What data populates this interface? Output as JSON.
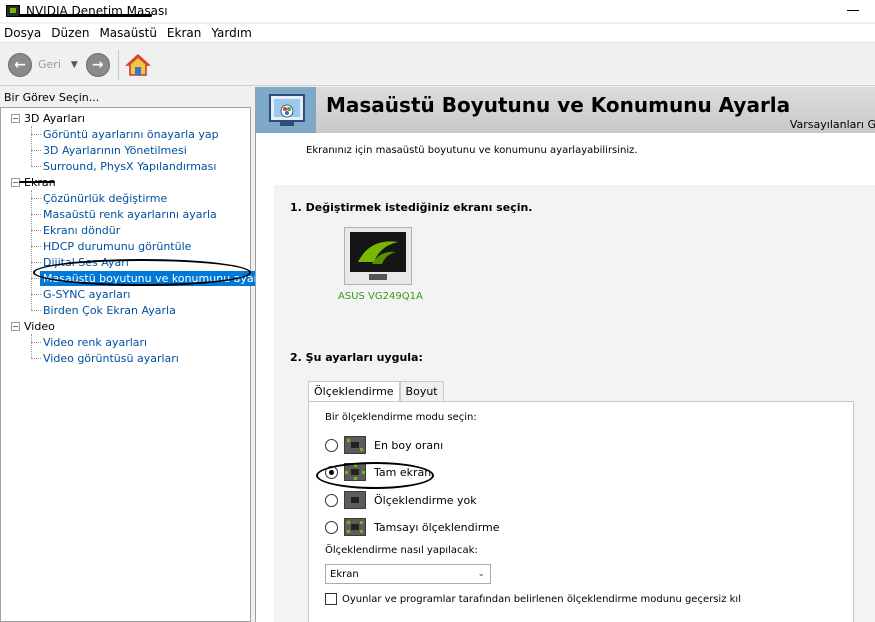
{
  "window": {
    "title": "NVIDIA Denetim Masası"
  },
  "menu": [
    "Dosya",
    "Düzen",
    "Masaüstü",
    "Ekran",
    "Yardım"
  ],
  "toolbar": {
    "back_label": "Geri",
    "back_icon": "arrow-left-icon",
    "forward_icon": "arrow-right-icon",
    "home_icon": "home-icon"
  },
  "left": {
    "header": "Bir Görev Seçin...",
    "tree": [
      {
        "label": "3D Ayarları",
        "expander": "−",
        "children": [
          "Görüntü ayarlarını önayarla yap",
          "3D Ayarlarının Yönetilmesi",
          "Surround, PhysX Yapılandırması"
        ]
      },
      {
        "label": "Ekran",
        "expander": "−",
        "children": [
          "Çözünürlük değiştirme",
          "Masaüstü renk ayarlarını ayarla",
          "Ekranı döndür",
          "HDCP durumunu görüntüle",
          "Dijital Ses Ayarı",
          "Masaüstü boyutunu ve konumunu ayarla",
          "G-SYNC ayarları",
          "Birden Çok Ekran Ayarla"
        ]
      },
      {
        "label": "Video",
        "expander": "−",
        "children": [
          "Video renk ayarları",
          "Video görüntüsü ayarları"
        ]
      }
    ],
    "selected": "Masaüstü boyutunu ve konumunu ayarla"
  },
  "right": {
    "title": "Masaüstü Boyutunu ve Konumunu Ayarla",
    "defaults": "Varsayılanları G",
    "description": "Ekranınız için masaüstü boyutunu ve konumunu ayarlayabilirsiniz.",
    "section1": "1. Değiştirmek istediğiniz ekranı seçin.",
    "monitor_label": "ASUS VG249Q1A",
    "section2": "2. Şu ayarları uygula:",
    "tabs": [
      "Ölçeklendirme",
      "Boyut"
    ],
    "scale_prompt": "Bir ölçeklendirme modu seçin:",
    "options": [
      {
        "label": "En boy oranı",
        "checked": false
      },
      {
        "label": "Tam ekran",
        "checked": true
      },
      {
        "label": "Ölçeklendirme yok",
        "checked": false
      },
      {
        "label": "Tamsayı ölçeklendirme",
        "checked": false
      }
    ],
    "how_label": "Ölçeklendirme nasıl yapılacak:",
    "select_value": "Ekran",
    "override_label": "Oyunlar ve programlar tarafından belirlenen ölçeklendirme modunu geçersiz kıl"
  },
  "colors": {
    "nvidia_green": "#76b900",
    "selection_blue": "#0078d7",
    "link_blue": "#0050a0"
  }
}
